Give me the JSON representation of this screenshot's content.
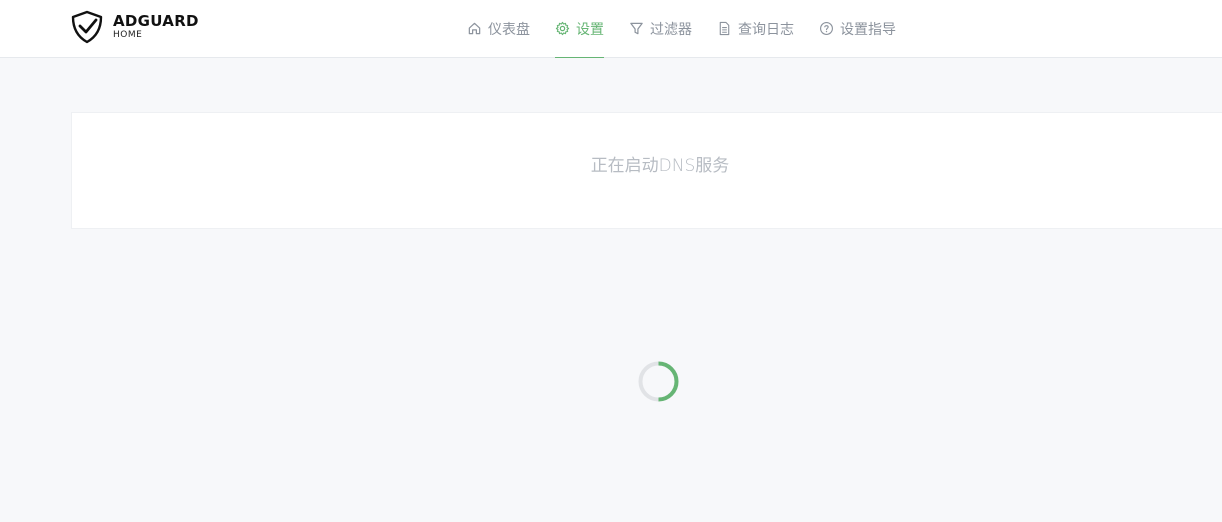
{
  "header": {
    "brand": "ADGUARD",
    "brand_sub": "HOME",
    "nav": [
      {
        "label": "仪表盘",
        "icon": "home-icon",
        "active": false
      },
      {
        "label": "设置",
        "icon": "gear-icon",
        "active": true
      },
      {
        "label": "过滤器",
        "icon": "filter-icon",
        "active": false
      },
      {
        "label": "查询日志",
        "icon": "document-icon",
        "active": false
      },
      {
        "label": "设置指导",
        "icon": "help-circle-icon",
        "active": false
      }
    ]
  },
  "main": {
    "status_message": "正在启动DNS服务"
  },
  "colors": {
    "accent": "#66b574",
    "muted_text": "#8c939d",
    "background": "#f7f8fa"
  }
}
